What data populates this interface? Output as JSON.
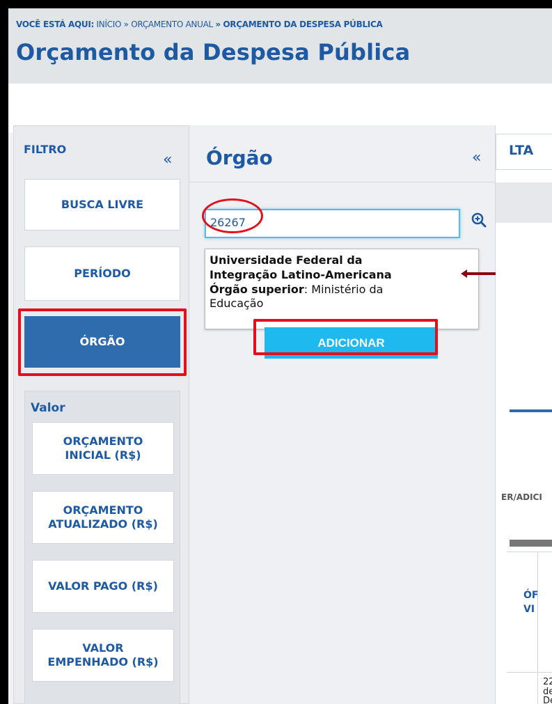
{
  "breadcrumb": {
    "prefix": "VOCÊ ESTÁ AQUI:",
    "inicio": "INÍCIO",
    "separator": "»",
    "orcamento_anual": "ORÇAMENTO ANUAL",
    "current": "ORÇAMENTO DA DESPESA PÚBLICA"
  },
  "page_title": "Orçamento da Despesa Pública",
  "filter": {
    "title": "FILTRO",
    "collapse_glyph": "«",
    "items": [
      {
        "label": "BUSCA LIVRE"
      },
      {
        "label": "PERÍODO"
      },
      {
        "label": "ÓRGÃO",
        "active": true
      }
    ],
    "valor": {
      "title": "Valor",
      "items": [
        {
          "label_line1": "ORÇAMENTO",
          "label_line2": "INICIAL (R$)"
        },
        {
          "label_line1": "ORÇAMENTO",
          "label_line2": "ATUALIZADO (R$)"
        },
        {
          "label_line1": "VALOR PAGO (R$)",
          "label_line2": ""
        },
        {
          "label_line1": "VALOR",
          "label_line2": "EMPENHADO (R$)"
        }
      ]
    }
  },
  "orgao_panel": {
    "title": "Órgão",
    "collapse_glyph": "«",
    "search_value": "26267",
    "suggestion": {
      "name_line1": "Universidade Federal da",
      "name_line2": "Integração Latino-Americana",
      "superior_label": "Órgão superior",
      "superior_value_line1": ": Ministério da",
      "superior_value_line2": "Educação"
    },
    "add_button": "ADICIONAR"
  },
  "right_panel": {
    "tab_label_partial": "LTA",
    "partial_text": "ER/ADICI",
    "column_header_line1": "ÓF",
    "column_header_line2": "VI",
    "cell_line1": "22",
    "cell_line2": "de",
    "cell_line3": "De"
  },
  "colors": {
    "brand_blue": "#1d5aa3",
    "active_blue": "#2e6cae",
    "button_cyan": "#1db9ef",
    "annotation_red": "#e3101c"
  }
}
